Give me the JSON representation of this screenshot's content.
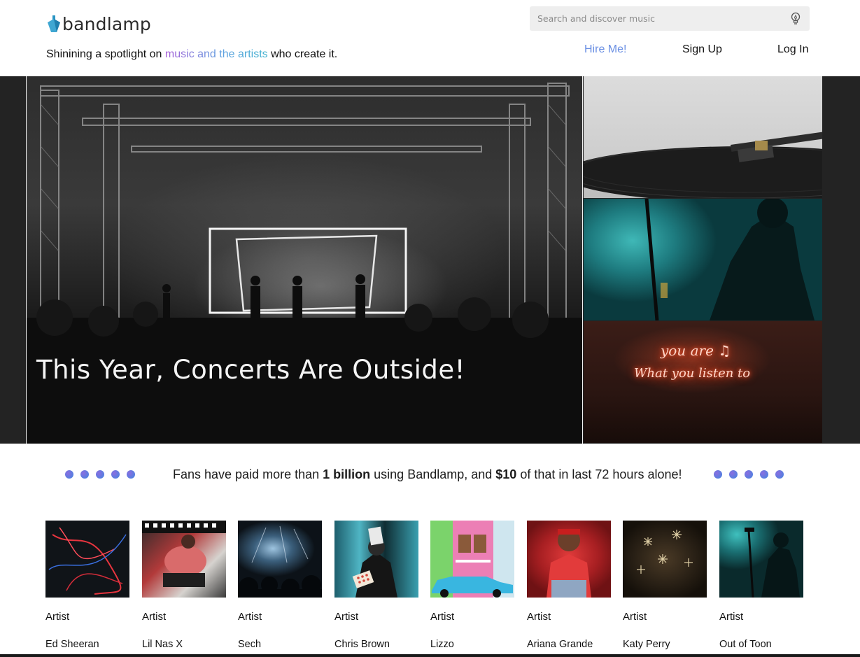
{
  "header": {
    "logo_text": "bandlamp",
    "tagline_before": "Shinining a spotlight on ",
    "tagline_highlight": "music and the artists",
    "tagline_after": " who create it.",
    "search_placeholder": "Search and discover music",
    "search_icon": "lightbulb-icon",
    "nav": {
      "hire": "Hire Me!",
      "signup": "Sign Up",
      "login": "Log In"
    }
  },
  "hero": {
    "title": "This Year, Concerts Are Outside!",
    "neon_line1": "you are ♫",
    "neon_line2": "What you listen to"
  },
  "banner": {
    "before": "Fans have paid more than ",
    "amount1": "1 billion",
    "middle": " using Bandlamp, and ",
    "amount2": "$10",
    "after": " of that in last 72 hours alone!"
  },
  "artists": [
    {
      "label": "Artist",
      "name": "Ed Sheeran"
    },
    {
      "label": "Artist",
      "name": "Lil Nas X"
    },
    {
      "label": "Artist",
      "name": "Sech"
    },
    {
      "label": "Artist",
      "name": "Chris Brown"
    },
    {
      "label": "Artist",
      "name": "Lizzo"
    },
    {
      "label": "Artist",
      "name": "Ariana Grande"
    },
    {
      "label": "Artist",
      "name": "Katy Perry"
    },
    {
      "label": "Artist",
      "name": "Out of Toon"
    }
  ],
  "colors": {
    "nav_accent": "#6a8fe3",
    "tagline_gradient": [
      "#a85fd8",
      "#3fb2cf"
    ],
    "dot_gradient": [
      "#8a6ee0",
      "#3f86e0"
    ],
    "hero_background": "#232323"
  }
}
